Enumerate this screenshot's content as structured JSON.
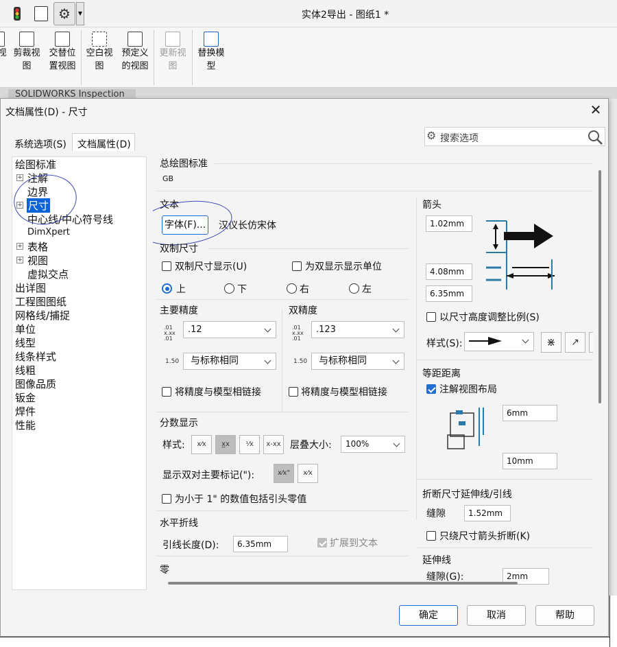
{
  "window": {
    "title": "实体2导出 - 图纸1 *"
  },
  "ribbon": {
    "items": [
      {
        "label": "视"
      },
      {
        "label": "剪裁视\n图"
      },
      {
        "label": "交替位\n置视图"
      },
      {
        "label": "空白视\n图"
      },
      {
        "label": "预定义\n的视图"
      },
      {
        "label": "更新视\n图",
        "disabled": true
      },
      {
        "label": "替换模\n型"
      }
    ]
  },
  "tabstrip": {
    "label": "SOLIDWORKS Inspection"
  },
  "dialog": {
    "title": "文档属性(D) - 尺寸",
    "tabs": [
      "系统选项(S)",
      "文档属性(D)"
    ],
    "search_placeholder": "搜索选项",
    "tree": [
      "绘图标准",
      "注解",
      "边界",
      "尺寸",
      "中心线/中心符号线",
      "DimXpert",
      "表格",
      "视图",
      "虚拟交点",
      "出详图",
      "工程图图纸",
      "网格线/捕捉",
      "单位",
      "线型",
      "线条样式",
      "线粗",
      "图像品质",
      "钣金",
      "焊件",
      "性能"
    ],
    "standard": {
      "header": "总绘图标准",
      "value": "GB"
    },
    "text": {
      "header": "文本",
      "font_button": "字体(F)...",
      "font_name": "汉仪长仿宋体"
    },
    "dual": {
      "header": "双制尺寸",
      "show": "双制尺寸显示(U)",
      "units": "为双显示显示单位",
      "pos": [
        "上",
        "下",
        "右",
        "左"
      ],
      "selected": "上"
    },
    "primary_precision": {
      "header": "主要精度",
      "value": ".12",
      "tolerance": "与标称相同",
      "link": "将精度与模型相链接"
    },
    "dual_precision": {
      "header": "双精度",
      "value": ".123",
      "tolerance": "与标称相同",
      "link": "将精度与模型相链接"
    },
    "fraction": {
      "header": "分数显示",
      "style_label": "样式:",
      "stack_label": "层叠大小:",
      "stack_value": "100%",
      "dual_mark": "显示双对主要标记(\"):",
      "leading_zero": "为小于 1\" 的数值包括引头零值"
    },
    "horizontal": {
      "header": "水平折线",
      "length_label": "引线长度(D):",
      "length_value": "6.35mm",
      "extend": "扩展到文本"
    },
    "zero": {
      "header": "零"
    },
    "arrows": {
      "header": "箭头",
      "v1": "1.02mm",
      "v2": "4.08mm",
      "v3": "6.35mm",
      "scale": "以尺寸高度调整比例(S)",
      "style_label": "样式(S):"
    },
    "offset": {
      "header": "等距距离",
      "annotate": "注解视图布局",
      "v1": "6mm",
      "v2": "10mm"
    },
    "break": {
      "header": "折断尺寸延伸线/引线",
      "gap_label": "缝隙",
      "gap_value": "1.52mm",
      "only_arrow": "只绕尺寸箭头折断(K)"
    },
    "extension": {
      "header": "延伸线",
      "gap_label": "缝隙(G):",
      "gap_value": "2mm"
    },
    "buttons": {
      "ok": "确定",
      "cancel": "取消",
      "help": "帮助"
    }
  }
}
